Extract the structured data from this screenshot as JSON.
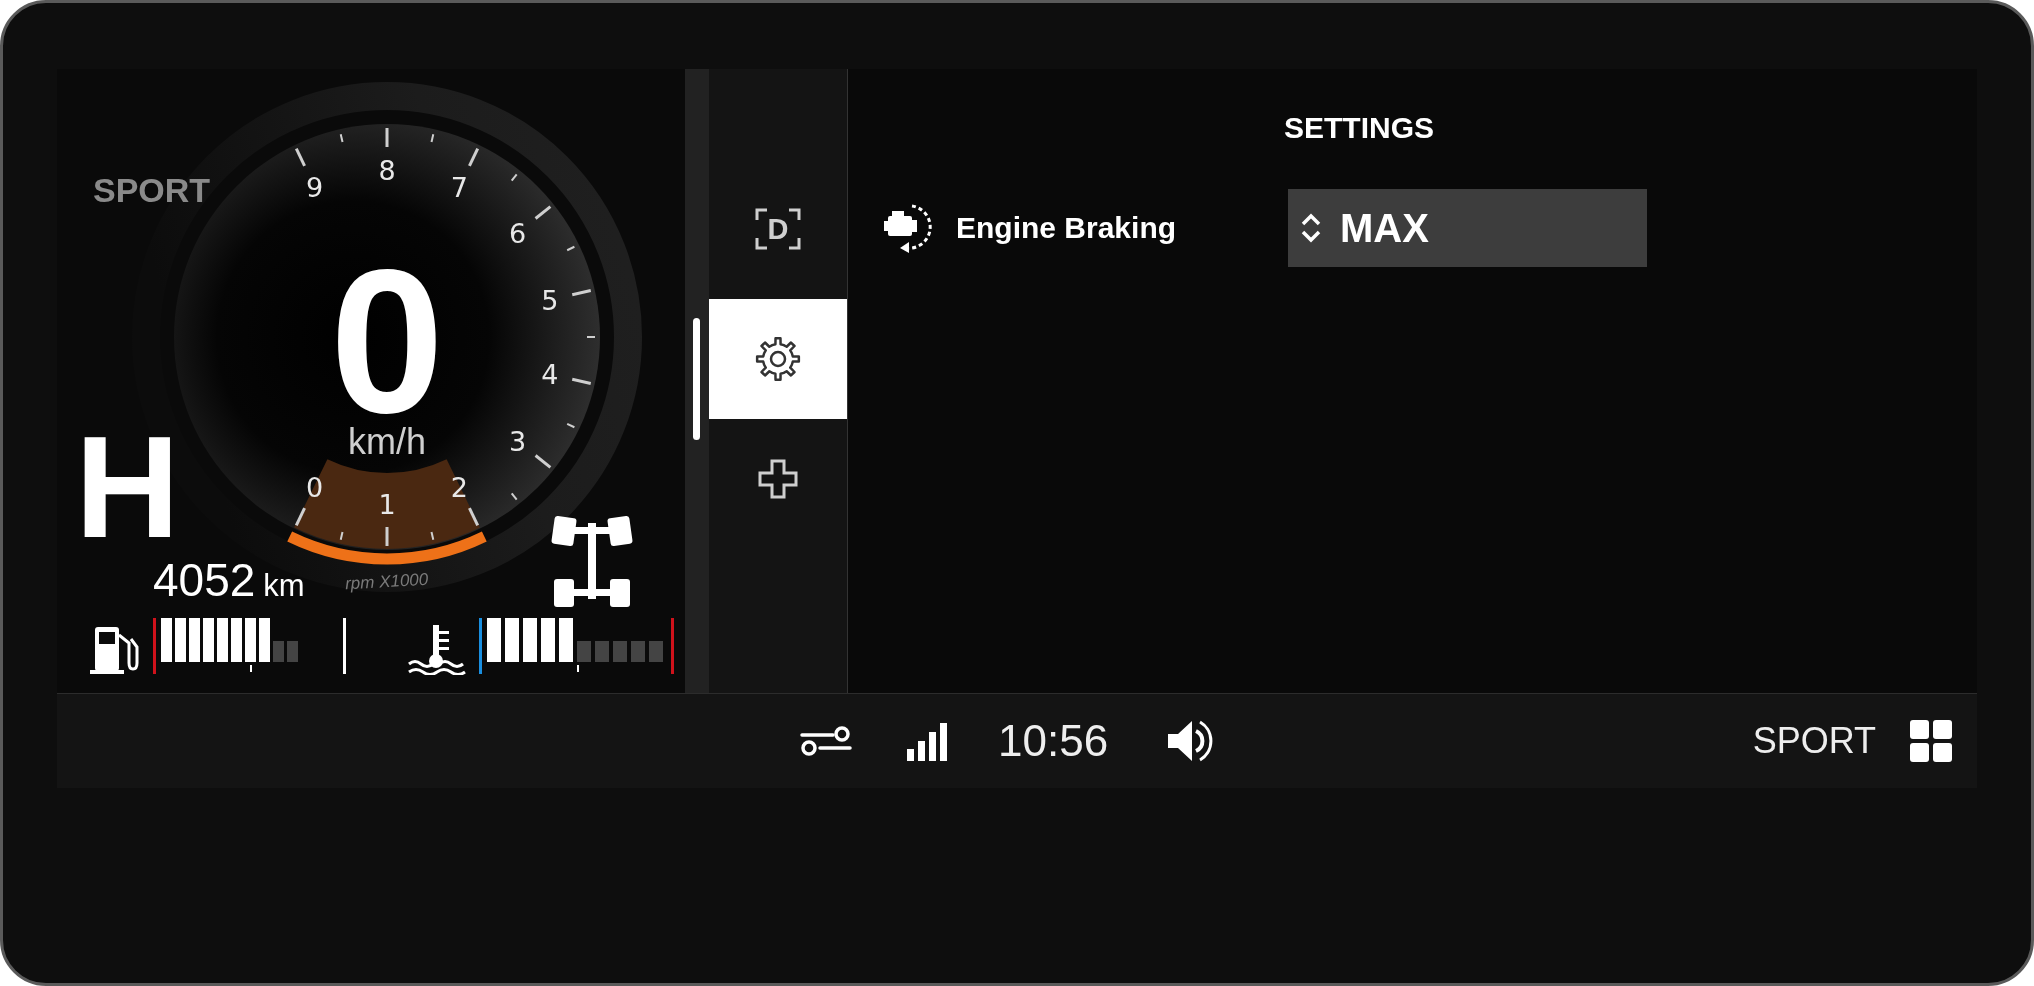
{
  "dashboard": {
    "drive_mode": "SPORT",
    "gear": "H",
    "speed": "0",
    "speed_unit": "km/h",
    "tachometer": {
      "labels": [
        "0",
        "1",
        "2",
        "3",
        "4",
        "5",
        "6",
        "7",
        "8",
        "9"
      ],
      "unit": "rpm X1000"
    },
    "odometer": {
      "value": "4052",
      "unit": "km"
    },
    "fuel": {
      "level": 0.8
    },
    "coolant": {
      "level": 0.5
    }
  },
  "sidebar": {
    "items": [
      {
        "kind": "drive",
        "label": "D",
        "selected": false
      },
      {
        "kind": "settings",
        "selected": true
      },
      {
        "kind": "add",
        "selected": false
      }
    ]
  },
  "settings": {
    "title": "SETTINGS",
    "rows": [
      {
        "label": "Engine Braking",
        "value": "MAX"
      }
    ]
  },
  "status_bar": {
    "time": "10:56",
    "mode": "SPORT"
  }
}
